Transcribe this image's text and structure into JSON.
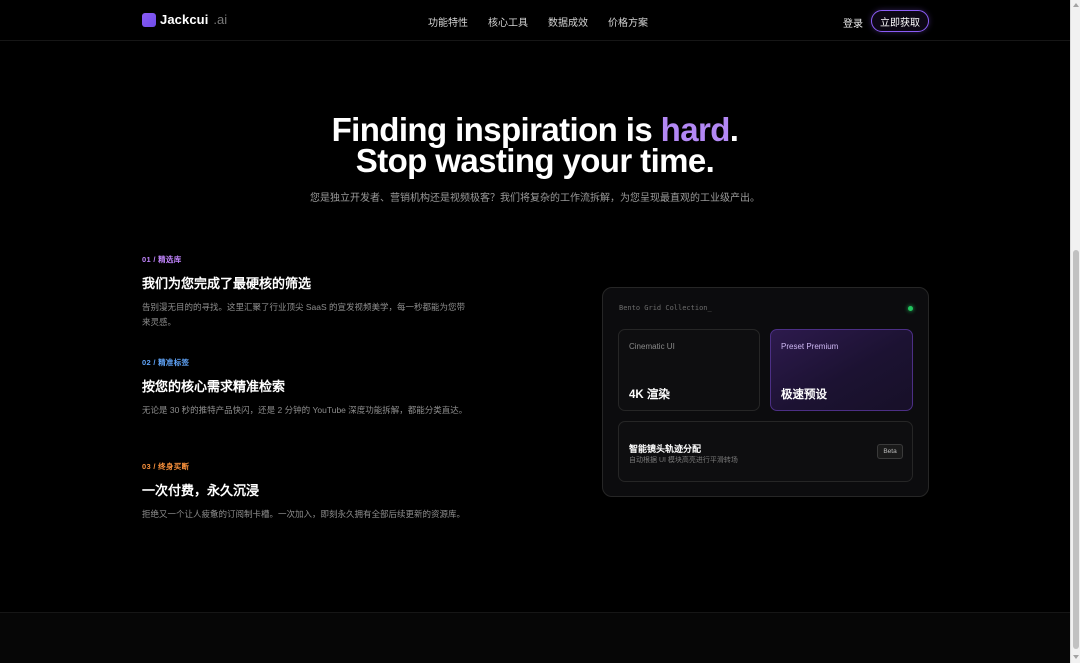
{
  "nav": {
    "brand": "Jackcui",
    "brand_suffix": ".ai",
    "links": [
      "功能特性",
      "核心工具",
      "数据成效",
      "价格方案"
    ],
    "login": "登录",
    "cta": "立即获取",
    "accent_color": "#8b5cf6"
  },
  "hero": {
    "title_line1_prefix": "Finding inspiration is ",
    "title_line1_accent": "hard",
    "title_line1_suffix": ".",
    "title_line2": "Stop wasting your time.",
    "subtitle": "您是独立开发者、营销机构还是视频极客？我们将复杂的工作流拆解，为您呈现最直观的工业级产出。",
    "accent_color": "#b388f5"
  },
  "features": [
    {
      "tag": "01 / 精选库",
      "tag_color": "#c084fc",
      "title": "我们为您完成了最硬核的筛选",
      "desc": "告别漫无目的的寻找。这里汇聚了行业顶尖 SaaS 的宣发视频美学，每一秒都能为您带来灵感。"
    },
    {
      "tag": "02 / 精准标签",
      "tag_color": "#60a5fa",
      "title": "按您的核心需求精准检索",
      "desc": "无论是 30 秒的推特产品快闪，还是 2 分钟的 YouTube 深度功能拆解，都能分类直达。"
    },
    {
      "tag": "03 / 终身买断",
      "tag_color": "#fb923c",
      "title": "一次付费，永久沉浸",
      "desc": "拒绝又一个让人疲惫的订阅制卡槽。一次加入，即刻永久拥有全部后续更新的资源库。"
    }
  ],
  "bento": {
    "title": "Bento Grid Collection_",
    "status_color": "#22c55e",
    "tiles": [
      {
        "label": "Cinematic UI",
        "value": "4K 渲染"
      },
      {
        "label": "Preset Premium",
        "value": "极速预设"
      }
    ],
    "wide_tile": {
      "title": "智能镜头轨迹分配",
      "desc": "自动根据 UI 模块高亮进行平滑转场",
      "badge": "Beta"
    }
  }
}
